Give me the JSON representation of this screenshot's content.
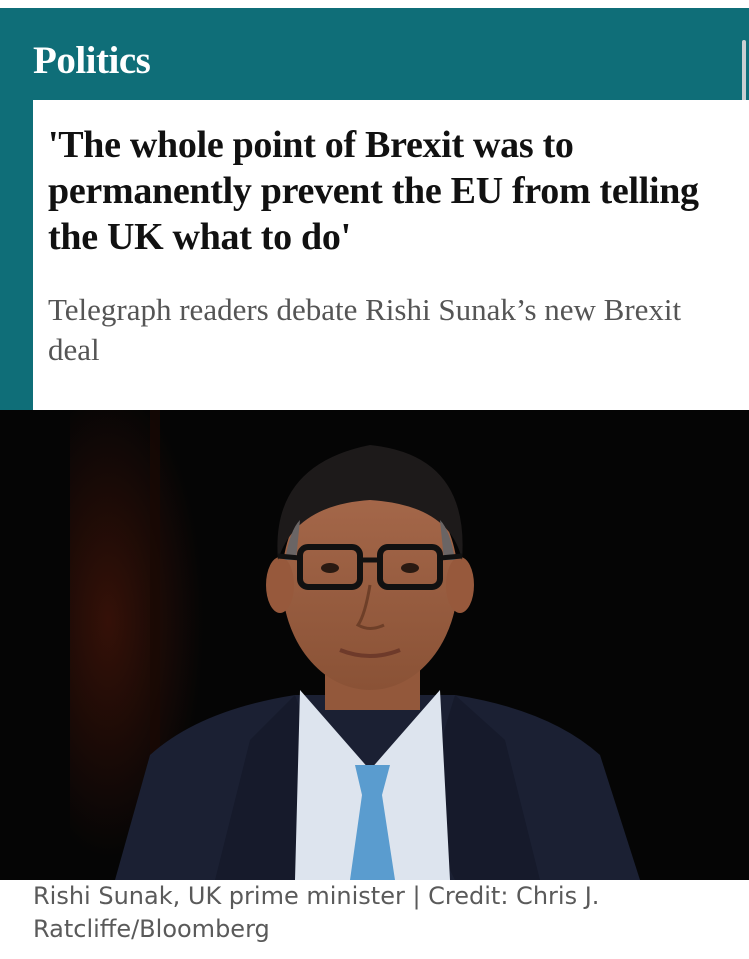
{
  "section": {
    "label": "Politics",
    "band_color": "#0f6e78"
  },
  "article": {
    "headline": "'The whole point of Brexit was to permanently prevent the EU from telling the UK what to do'",
    "standfirst": "Telegraph readers debate Rishi Sunak’s new Brexit deal"
  },
  "image": {
    "subject": "portrait-of-man-in-suit-and-glasses",
    "caption": "Rishi Sunak, UK prime minister | Credit: Chris J. Ratcliffe/Bloomberg"
  }
}
